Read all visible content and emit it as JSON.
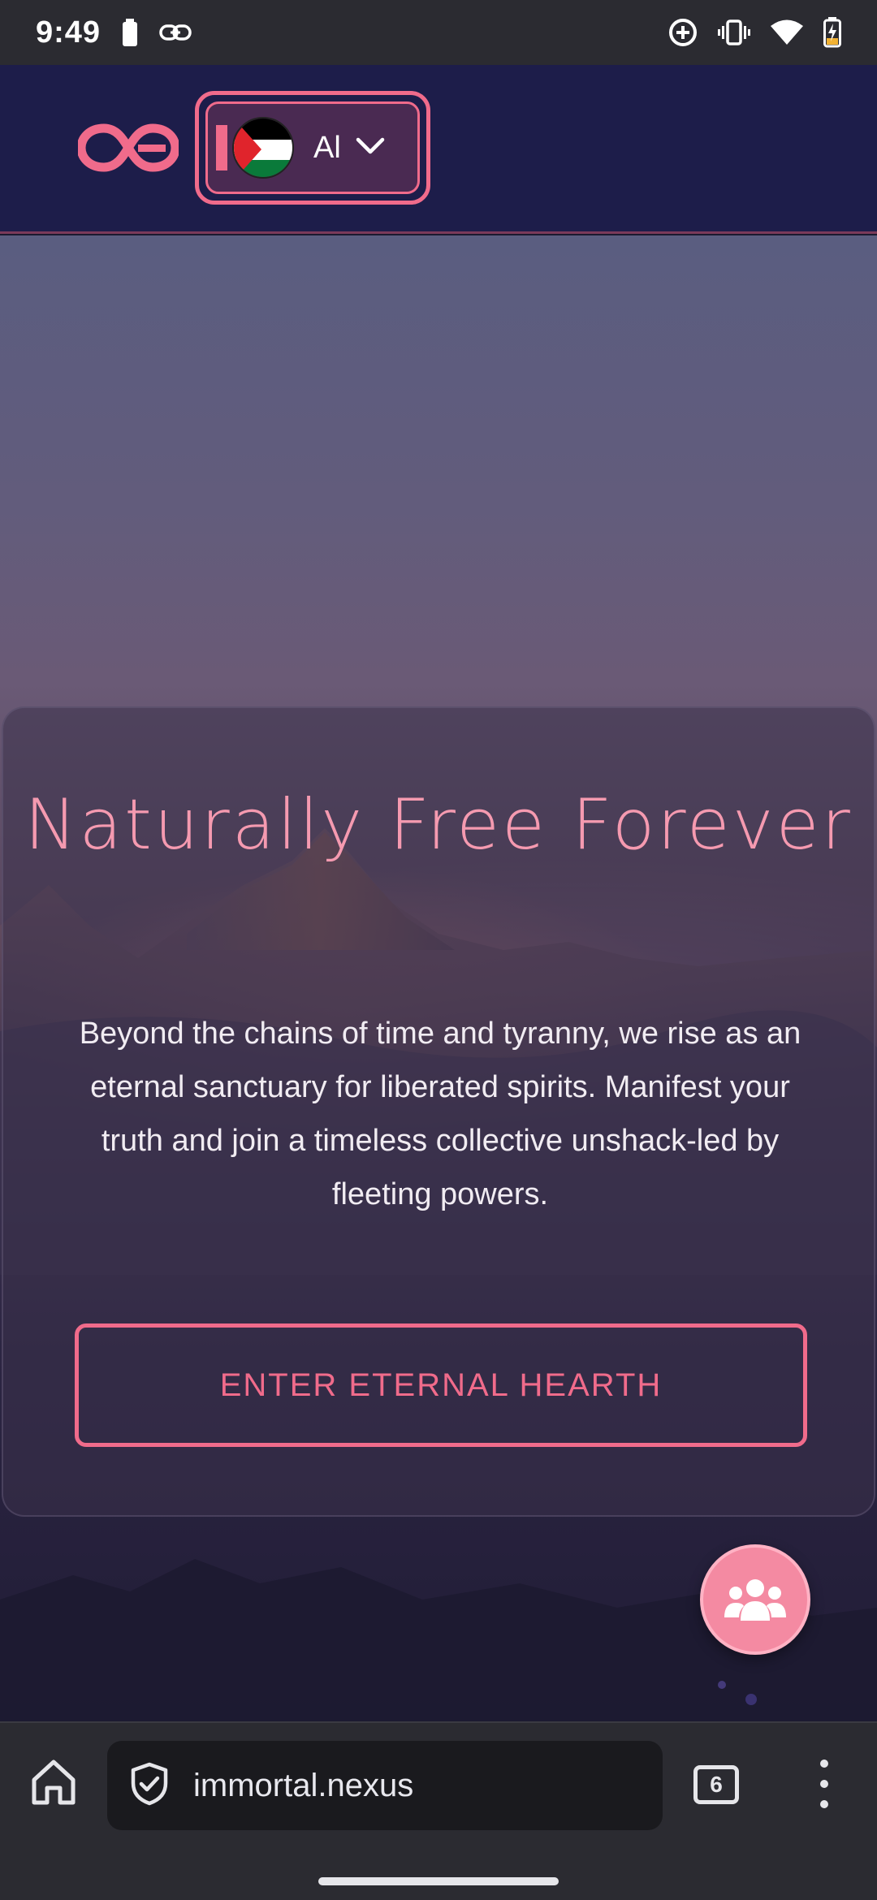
{
  "status_bar": {
    "time": "9:49",
    "icons": [
      "battery-saver-icon",
      "link-icon",
      "data-saver-icon",
      "vibrate-icon",
      "wifi-icon",
      "battery-charging-icon"
    ]
  },
  "header": {
    "logo_icon": "infinity-logo-icon",
    "language": {
      "label": "Al",
      "flag_icon": "palestine-flag-icon",
      "chevron_icon": "chevron-down-icon"
    },
    "colors": {
      "background": "#1d1d4a",
      "accent": "#f06b8b"
    }
  },
  "hero": {
    "title": "Naturally Free Forever",
    "description": "Beyond the chains of time and tyranny, we rise as an eternal sanctuary for liberated spirits. Manifest your truth and join a timeless collective unshack-led by fleeting powers.",
    "cta_label": "ENTER ETERNAL HEARTH",
    "colors": {
      "title": "#f59ab0",
      "cta": "#f06b8b"
    }
  },
  "fab": {
    "icon": "community-users-icon",
    "color": "#f48aa2"
  },
  "browser": {
    "url": "immortal.nexus",
    "tab_count": "6",
    "home_icon": "home-icon",
    "security_icon": "shield-check-icon",
    "menu_icon": "more-vert-icon"
  }
}
